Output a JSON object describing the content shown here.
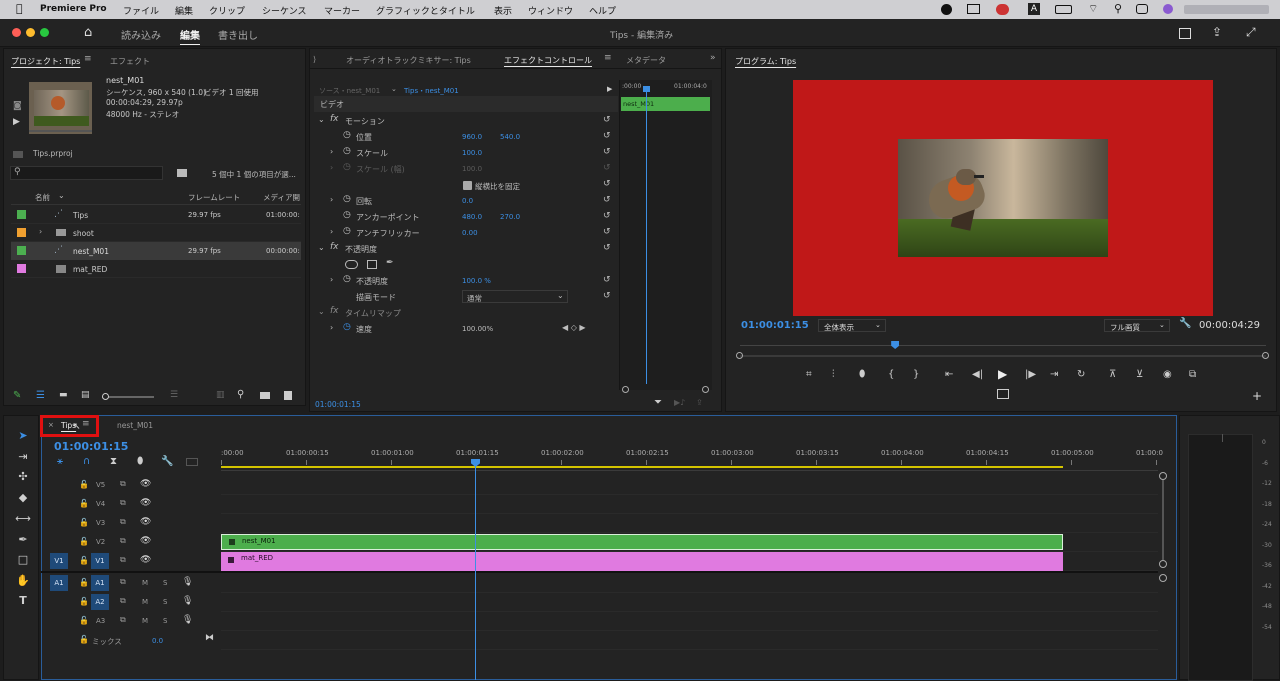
{
  "menubar": {
    "app_name": "Premiere Pro",
    "items": [
      "ファイル",
      "編集",
      "クリップ",
      "シーケンス",
      "マーカー",
      "グラフィックとタイトル",
      "表示",
      "ウィンドウ",
      "ヘルプ"
    ]
  },
  "workspace": {
    "tabs": [
      "読み込み",
      "編集",
      "書き出し"
    ],
    "active_tab": "編集",
    "title": "Tips - 編集済み"
  },
  "project_panel": {
    "tab_project": "プロジェクト: Tips",
    "tab_effects": "エフェクト",
    "clip_name": "nest_M01",
    "clip_info_1": "シーケンス, 960 x 540 (1.0)",
    "clip_info_1b": "ビデオ 1 回使用",
    "clip_info_2": "00:00:04:29, 29.97p",
    "clip_info_3": "48000 Hz - ステレオ",
    "project_file": "Tips.prproj",
    "selection_status": "5 個中 1 個の項目が選...",
    "columns": [
      "名前",
      "フレームレート",
      "メディア開"
    ],
    "items": [
      {
        "name": "Tips",
        "fps": "29.97 fps",
        "media": "01:00:00:",
        "color": "#4caf50",
        "type": "sequence"
      },
      {
        "name": "shoot",
        "fps": "",
        "media": "",
        "color": "#f0a030",
        "type": "folder"
      },
      {
        "name": "nest_M01",
        "fps": "29.97 fps",
        "media": "00:00:00:",
        "color": "#4caf50",
        "type": "sequence"
      },
      {
        "name": "mat_RED",
        "fps": "",
        "media": "",
        "color": "#e07ae0",
        "type": "matte"
      }
    ]
  },
  "effect_controls": {
    "tabs": [
      "オーディオトラックミキサー: Tips",
      "エフェクトコントロール",
      "メタデータ"
    ],
    "source_label": "ソース・nest_M01",
    "sequence_label": "Tips・nest_M01",
    "section_video": "ビデオ",
    "motion": "モーション",
    "position_label": "位置",
    "position_x": "960.0",
    "position_y": "540.0",
    "scale_label": "スケール",
    "scale_value": "100.0",
    "scale_width_label": "スケール (幅)",
    "scale_width_value": "100.0",
    "uniform_scale_label": "縦横比を固定",
    "rotation_label": "回転",
    "rotation_value": "0.0",
    "anchor_label": "アンカーポイント",
    "anchor_x": "480.0",
    "anchor_y": "270.0",
    "antiflicker_label": "アンチフリッカー",
    "antiflicker_value": "0.00",
    "opacity_section": "不透明度",
    "opacity_label": "不透明度",
    "opacity_value": "100.0 %",
    "blend_label": "描画モード",
    "blend_value": "通常",
    "timeremap_section": "タイムリマップ",
    "speed_label": "速度",
    "speed_value": "100.00%",
    "mini_timecode_start": ":00:00",
    "mini_timecode_end": "01:00:04:0",
    "mini_clip": "nest_M01",
    "timecode": "01:00:01:15"
  },
  "program_monitor": {
    "title": "プログラム: Tips",
    "timecode": "01:00:01:15",
    "zoom": "全体表示",
    "quality": "フル画質",
    "duration": "00:00:04:29",
    "playhead_fraction": 0.295
  },
  "timeline": {
    "tab_active": "Tips",
    "tab_other": "nest_M01",
    "timecode": "01:00:01:15",
    "ruler": [
      ":00:00",
      "01:00:00:15",
      "01:00:01:00",
      "01:00:01:15",
      "01:00:02:00",
      "01:00:02:15",
      "01:00:03:00",
      "01:00:03:15",
      "01:00:04:00",
      "01:00:04:15",
      "01:00:05:00",
      "01:00:0"
    ],
    "video_tracks": [
      "V5",
      "V4",
      "V3",
      "V2",
      "V1"
    ],
    "audio_tracks": [
      "A1",
      "A2",
      "A3"
    ],
    "mix_label": "ミックス",
    "mix_value": "0.0",
    "source_v": "V1",
    "source_a": "A1",
    "clip_v2": "nest_M01",
    "clip_v1": "mat_RED",
    "mute": "M",
    "solo": "S"
  },
  "audio_meter": {
    "scale": [
      "0",
      "-6",
      "-12",
      "-18",
      "-24",
      "-30",
      "-36",
      "-42",
      "-48",
      "-54"
    ]
  },
  "colors": {
    "accent_blue": "#3c8fe4",
    "clip_green": "#4cae4c",
    "clip_pink": "#e07ae0",
    "program_red": "#c01818",
    "highlight_box": "#e01010"
  }
}
